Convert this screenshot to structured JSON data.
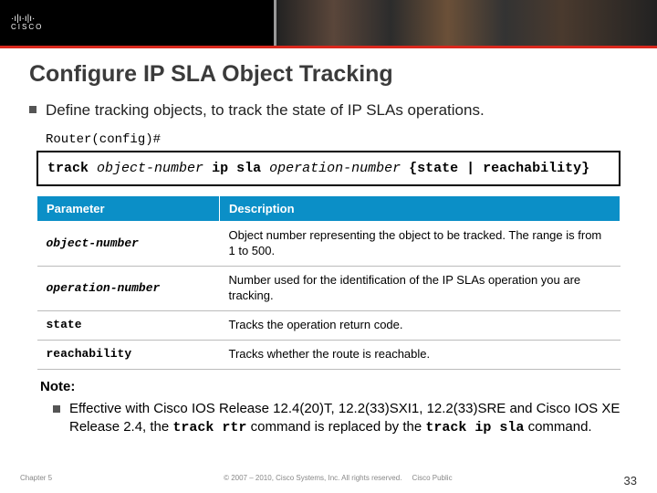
{
  "header": {
    "logo_text": "CISCO"
  },
  "title": "Configure IP SLA Object Tracking",
  "intro_bullet": "Define tracking objects, to track the state of IP SLAs operations.",
  "prompt": "Router(config)#",
  "command": {
    "k1": "track",
    "i1": "object-number",
    "k2": "ip sla",
    "i2": "operation-number",
    "k3": "{state | reachability}"
  },
  "table": {
    "headers": {
      "param": "Parameter",
      "desc": "Description"
    },
    "rows": [
      {
        "name": "object-number",
        "italic": true,
        "desc": "Object number representing the object to be tracked. The range is from 1 to 500."
      },
      {
        "name": "operation-number",
        "italic": true,
        "desc": "Number used for the identification of the IP SLAs operation you are tracking."
      },
      {
        "name": "state",
        "italic": false,
        "desc": "Tracks the operation return code."
      },
      {
        "name": "reachability",
        "italic": false,
        "desc": "Tracks whether the route is reachable."
      }
    ]
  },
  "note": {
    "label": "Note:",
    "pre": "Effective with Cisco IOS Release 12.4(20)T, 12.2(33)SXI1, 12.2(33)SRE and Cisco IOS XE Release 2.4, the ",
    "cmd1": "track rtr",
    "mid": " command is replaced by the ",
    "cmd2": "track ip sla",
    "post": " command."
  },
  "footer": {
    "chapter": "Chapter 5",
    "copyright": "© 2007 – 2010, Cisco Systems, Inc. All rights reserved.",
    "classification": "Cisco Public",
    "page": "33"
  }
}
